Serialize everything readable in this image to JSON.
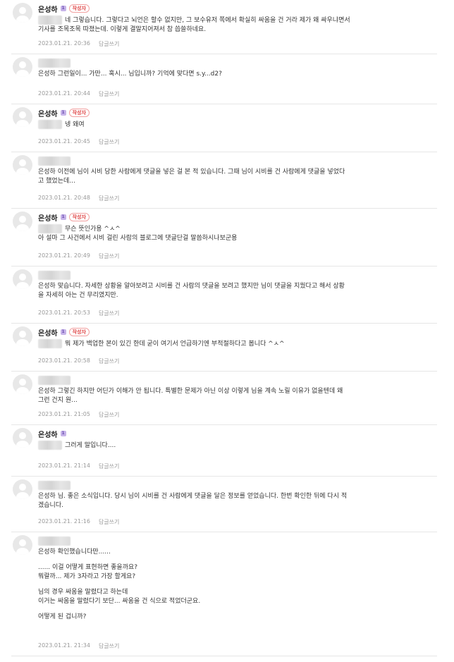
{
  "author_badge": "작성자",
  "author_name": "은성하",
  "reply_label": "답글쓰기",
  "comments": [
    {
      "author": "은성하",
      "badge": "작성자",
      "blurred_head": true,
      "lines": [
        "네 그렇습니다. 그렇다고 뇌언은 할수 없지만, 그 보수유저 쪽에서 확실히 싸움을 건 거라 제가 왜 싸우냐면서",
        "기사를 조목조목 따졌는데. 이렇게 결말지어져서 참 씁쓸하네요."
      ],
      "timestamp": "2023.01.21. 20:36"
    },
    {
      "author": "",
      "badge": "",
      "mention": "은성하",
      "lines": [
        "그런일이... 가만... 혹시... 님입니까? 기억에 맞다면 s.y...d2?"
      ],
      "timestamp": "2023.01.21. 20:44"
    },
    {
      "author": "은성하",
      "badge": "작성자",
      "blurred_head": true,
      "lines": [
        "넹 왜여"
      ],
      "timestamp": "2023.01.21. 20:45"
    },
    {
      "author": "",
      "badge": "",
      "mention": "은성하",
      "lines": [
        "이전에 님이 시비 당한 사람에게 댓글을 넣은 걸 본 적 있습니다. 그때 님이 시비를 건 사람에게 댓글을 넣었다",
        "고 했었는데..."
      ],
      "timestamp": "2023.01.21. 20:48"
    },
    {
      "author": "은성하",
      "badge": "작성자",
      "blurred_head": true,
      "lines": [
        "무슨 뜻인가용 ^ㅅ^",
        "아 설마 그 사건에서 시비 걸린 사람의 블로그에 댓글단걸 말씀하시나보군용"
      ],
      "timestamp": "2023.01.21. 20:49"
    },
    {
      "author": "",
      "badge": "",
      "mention": "은성하",
      "lines": [
        "맞습니다. 자세한 상황을 알아보려고 시비를 건 사람의 댓글을 보려고 했지만 님이 댓글을 지웠다고 해서 상황",
        "을 자세히 아는 건 무리였지만."
      ],
      "timestamp": "2023.01.21. 20:53"
    },
    {
      "author": "은성하",
      "badge": "작성자",
      "blurred_head": true,
      "lines": [
        "뭐 제가 백업한 본이 있긴 한데 굳이 여기서 언급하기엔 부적절하다고 봅니다 ^ㅅ^"
      ],
      "timestamp": "2023.01.21. 20:58"
    },
    {
      "author": "",
      "badge": "",
      "mention": "은성하",
      "lines": [
        "그렇긴 하지만 어딘가 이해가 안 됩니다. 특별한 문제가 아닌 이상 이렇게 님을 계속 노릴 이유가 없을텐데 왜",
        "그런 건지 원..."
      ],
      "timestamp": "2023.01.21. 21:05"
    },
    {
      "author": "은성하",
      "badge": "",
      "blurred_head": true,
      "lines": [
        "그러게 말입니다...."
      ],
      "timestamp": "2023.01.21. 21:14"
    },
    {
      "author": "",
      "badge": "",
      "mention": "은성하",
      "lines": [
        "님. 좋은 소식입니다. 당시 님이 시비를 건 사람에게 댓글을 달은 정보를 얻었습니다. 한번 확인한 뒤에 다시 적",
        "겠습니다."
      ],
      "timestamp": "2023.01.21. 21:16"
    },
    {
      "author": "",
      "badge": "",
      "mention": "은성하",
      "lines": [
        "확인했습니다만......",
        "",
        "...... 이걸 어떻게 표현하면 좋을까요?",
        "뭐랄까... 제가 3자라고 가장 할게요?",
        "",
        "님의 경우 싸움을 말렸다고 하는데",
        "이거는 싸움을 말렸다기 보단... 싸움을 건 식으로 적었더군요.",
        "",
        "어떻게 된 겁니까?"
      ],
      "timestamp": "2023.01.21. 21:34"
    }
  ]
}
